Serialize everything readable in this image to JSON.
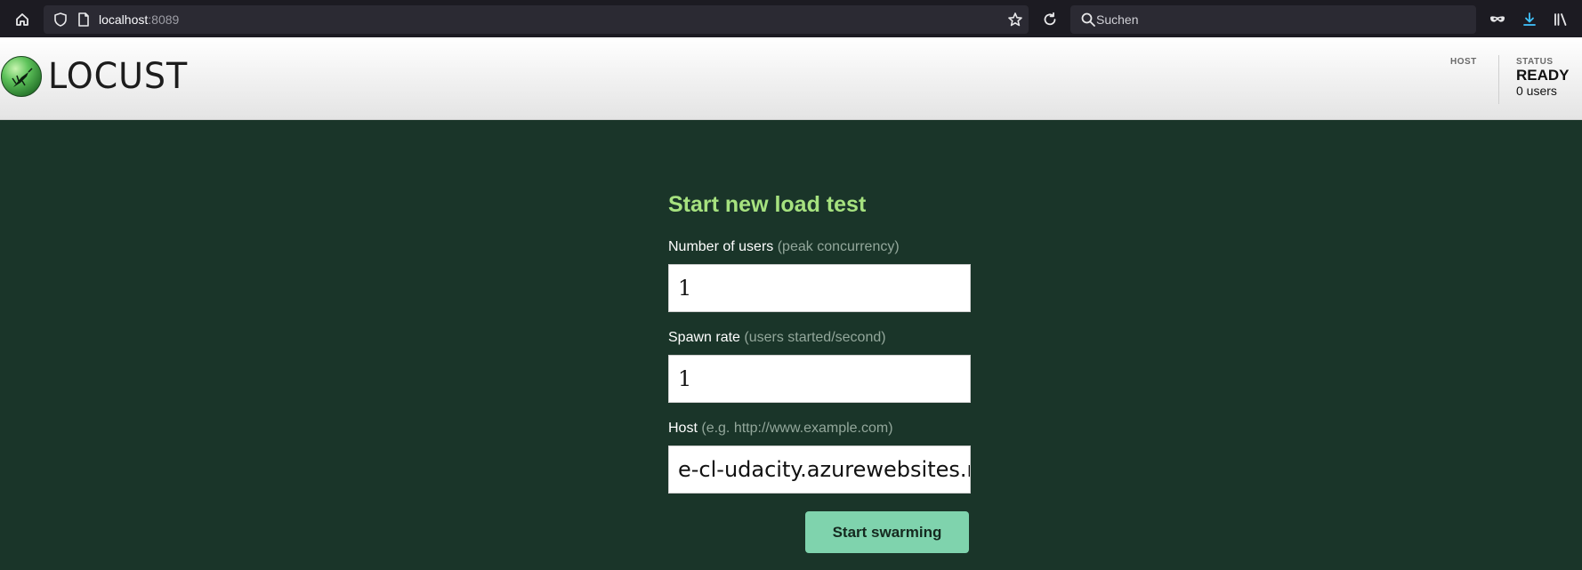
{
  "browser": {
    "url_host": "localhost",
    "url_port": ":8089",
    "search_placeholder": "Suchen"
  },
  "header": {
    "logo_text": "LOCUST",
    "host_label": "HOST",
    "status_label": "STATUS",
    "status_value": "READY",
    "user_count": "0 users"
  },
  "form": {
    "title": "Start new load test",
    "users_label": "Number of users",
    "users_hint": "(peak concurrency)",
    "users_value": "1",
    "spawn_label": "Spawn rate",
    "spawn_hint": "(users started/second)",
    "spawn_value": "1",
    "host_label": "Host",
    "host_hint": "(e.g. http://www.example.com)",
    "host_value": "e-cl-udacity.azurewebsites.net/",
    "submit_label": "Start swarming"
  },
  "colors": {
    "page_background": "#1a3529",
    "title_green": "#a6e27f",
    "button_green": "#7fd3ad"
  }
}
